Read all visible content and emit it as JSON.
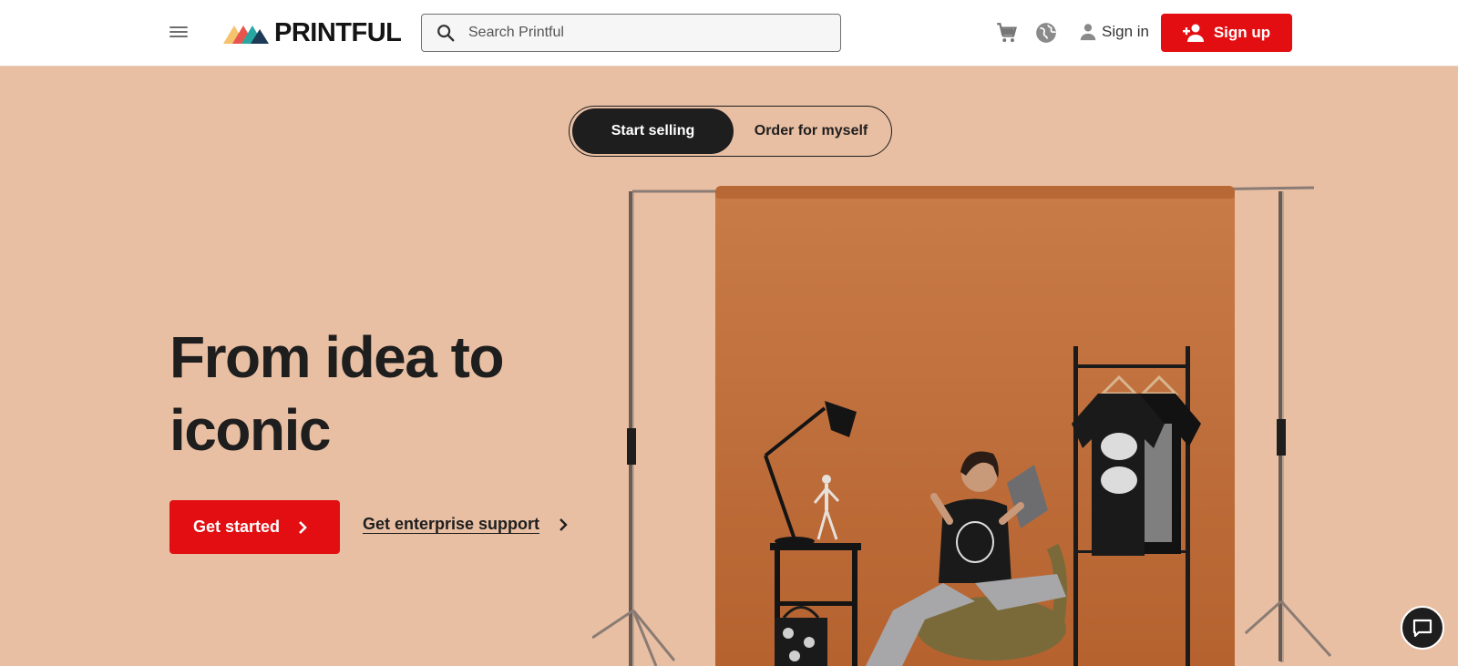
{
  "header": {
    "brand": "PRINTFUL",
    "search_placeholder": "Search Printful",
    "signin_label": "Sign in",
    "signup_label": "Sign up"
  },
  "toggle": {
    "options": [
      "Start selling",
      "Order for myself"
    ],
    "selected": "Start selling"
  },
  "hero": {
    "title_line1": "From idea to",
    "title_line2": "iconic",
    "cta_label": "Get started",
    "secondary_link": "Get enterprise support"
  },
  "colors": {
    "accent": "#e20e11",
    "hero_bg": "#e9bfa3",
    "backdrop": "#c0703c",
    "dark": "#1e1e1e"
  },
  "icons": [
    "menu-icon",
    "search-icon",
    "cart-icon",
    "globe-icon",
    "user-icon",
    "add-user-icon",
    "chevron-right-icon",
    "chat-icon"
  ]
}
